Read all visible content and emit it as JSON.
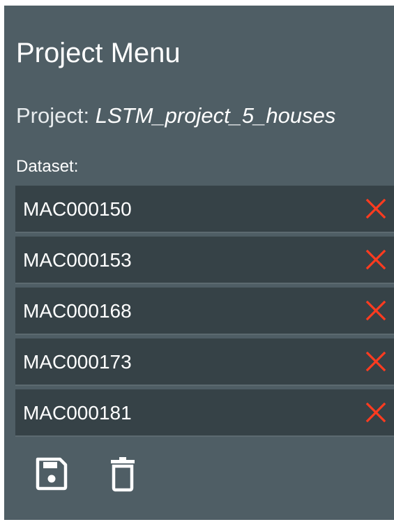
{
  "panel": {
    "title": "Project Menu",
    "project_label": "Project: ",
    "project_name": "LSTM_project_5_houses",
    "dataset_label": "Dataset:"
  },
  "datasets": [
    {
      "name": "MAC000150",
      "remove_icon": "close-icon"
    },
    {
      "name": "MAC000153",
      "remove_icon": "close-icon"
    },
    {
      "name": "MAC000168",
      "remove_icon": "close-icon"
    },
    {
      "name": "MAC000173",
      "remove_icon": "close-icon"
    },
    {
      "name": "MAC000181",
      "remove_icon": "close-icon"
    }
  ],
  "actions": {
    "save_icon": "save-icon",
    "delete_icon": "trash-icon"
  },
  "colors": {
    "panel_background": "#4f5e65",
    "row_background": "#364247",
    "remove_icon": "#ff3b1f",
    "text": "#ffffff"
  }
}
